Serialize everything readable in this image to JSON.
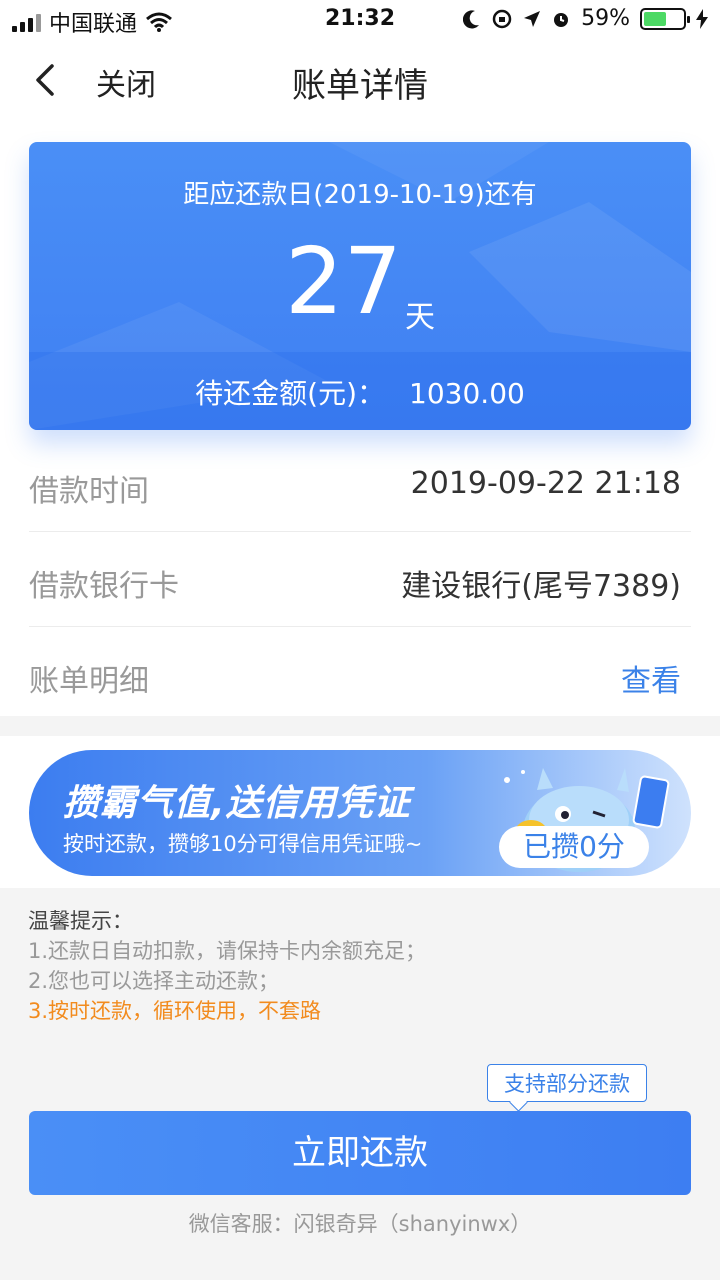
{
  "status_bar": {
    "carrier": "中国联通",
    "time": "21:32",
    "battery": "59%",
    "battery_level": 0.59,
    "icons": [
      "signal-icon",
      "wifi-icon",
      "moon-icon",
      "rotation-lock-icon",
      "location-icon",
      "alarm-icon",
      "battery-icon",
      "charging-icon"
    ]
  },
  "nav": {
    "close_label": "关闭",
    "title": "账单详情"
  },
  "summary_card": {
    "countdown_label": "距应还款日(2019-10-19)还有",
    "days": "27",
    "days_unit": "天",
    "amount_label": "待还金额(元)：",
    "amount": "1030.00"
  },
  "details": [
    {
      "label": "借款时间",
      "value": "2019-09-22 21:18"
    },
    {
      "label": "借款银行卡",
      "value": "建设银行(尾号7389)"
    },
    {
      "label": "账单明细",
      "value": "查看"
    }
  ],
  "banner": {
    "title": "攒霸气值,送信用凭证",
    "subtitle": "按时还款，攒够10分可得信用凭证哦~",
    "score_pill": "已攒0分"
  },
  "tips": {
    "title": "温馨提示：",
    "items": [
      "1.还款日自动扣款，请保持卡内余额充足；",
      "2.您也可以选择主动还款；",
      "3.按时还款，循环使用，不套路"
    ]
  },
  "partial_bubble": "支持部分还款",
  "pay_button": "立即还款",
  "service": "微信客服：闪银奇异（shanyinwx）",
  "colors": {
    "accent": "#3f7ff2",
    "highlight": "#f28b1e",
    "link": "#3b82e8"
  }
}
